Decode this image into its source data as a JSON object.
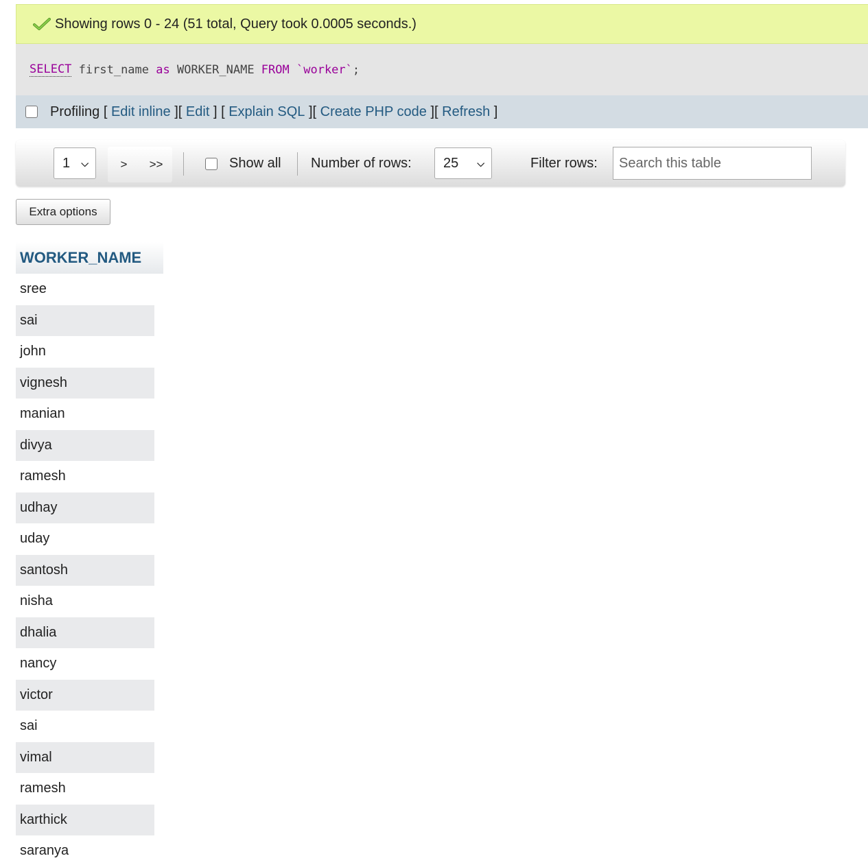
{
  "status": {
    "message": "Showing rows 0 - 24 (51 total, Query took 0.0005 seconds.)"
  },
  "sql": {
    "select": "SELECT",
    "part1": " first_name ",
    "as": "as",
    "part2": " WORKER_NAME ",
    "from": "FROM",
    "part3": " ",
    "table": "`worker`",
    "end": ";"
  },
  "profiling": {
    "label": "Profiling",
    "edit_inline": "Edit inline",
    "edit": "Edit",
    "explain_sql": "Explain SQL",
    "create_php": "Create PHP code",
    "refresh": "Refresh",
    "open": "[",
    "close": "]"
  },
  "navigation": {
    "page_selected": "1",
    "next": ">",
    "last": ">>",
    "show_all": "Show all",
    "number_of_rows_label": "Number of rows:",
    "number_of_rows_value": "25",
    "filter_label": "Filter rows:",
    "search_placeholder": "Search this table"
  },
  "extra_options": "Extra options",
  "table": {
    "column": "WORKER_NAME",
    "rows": [
      "sree",
      "sai",
      "john",
      "vignesh",
      "manian",
      "divya",
      "ramesh",
      "udhay",
      "uday",
      "santosh",
      "nisha",
      "dhalia",
      "nancy",
      "victor",
      "sai",
      "vimal",
      "ramesh",
      "karthick",
      "saranya"
    ]
  },
  "colors": {
    "success_bg": "#ebf8a4",
    "link": "#235a81",
    "sql_keyword": "#990099",
    "sql_string": "#aa1111"
  }
}
